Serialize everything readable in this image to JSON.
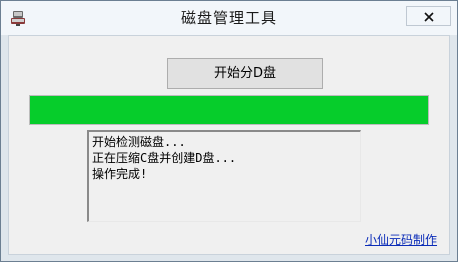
{
  "window": {
    "title": "磁盘管理工具",
    "icons": {
      "app": "disk-app-icon",
      "close": "close-icon"
    }
  },
  "main": {
    "split_button_label": "开始分D盘",
    "progress_fraction": 1.0,
    "progress_color": "#06cd2b",
    "log_lines": [
      "开始检测磁盘...",
      "正在压缩C盘并创建D盘...",
      "操作完成!"
    ],
    "credit_link": "小仙元码制作"
  }
}
